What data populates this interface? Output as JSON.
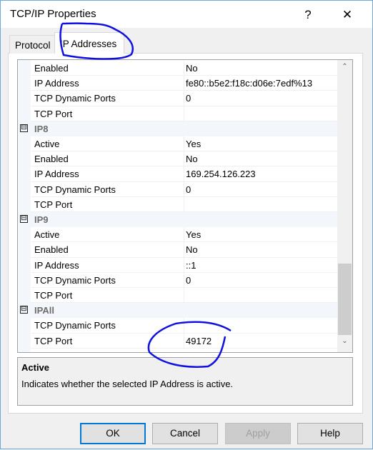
{
  "window": {
    "title": "TCP/IP Properties",
    "help_label": "?",
    "close_label": "✕"
  },
  "tabs": [
    {
      "label": "Protocol",
      "active": false
    },
    {
      "label": "IP Addresses",
      "active": true
    }
  ],
  "grid": {
    "rows": [
      {
        "type": "prop",
        "name": "Enabled",
        "value": "No"
      },
      {
        "type": "prop",
        "name": "IP Address",
        "value": "fe80::b5e2:f18c:d06e:7edf%13"
      },
      {
        "type": "prop",
        "name": "TCP Dynamic Ports",
        "value": "0"
      },
      {
        "type": "prop",
        "name": "TCP Port",
        "value": ""
      },
      {
        "type": "category",
        "name": "IP8",
        "toggle": "⊟"
      },
      {
        "type": "prop",
        "name": "Active",
        "value": "Yes"
      },
      {
        "type": "prop",
        "name": "Enabled",
        "value": "No"
      },
      {
        "type": "prop",
        "name": "IP Address",
        "value": "169.254.126.223"
      },
      {
        "type": "prop",
        "name": "TCP Dynamic Ports",
        "value": "0"
      },
      {
        "type": "prop",
        "name": "TCP Port",
        "value": ""
      },
      {
        "type": "category",
        "name": "IP9",
        "toggle": "⊟"
      },
      {
        "type": "prop",
        "name": "Active",
        "value": "Yes"
      },
      {
        "type": "prop",
        "name": "Enabled",
        "value": "No"
      },
      {
        "type": "prop",
        "name": "IP Address",
        "value": "::1"
      },
      {
        "type": "prop",
        "name": "TCP Dynamic Ports",
        "value": "0"
      },
      {
        "type": "prop",
        "name": "TCP Port",
        "value": ""
      },
      {
        "type": "category",
        "name": "IPAll",
        "toggle": "⊟"
      },
      {
        "type": "prop",
        "name": "TCP Dynamic Ports",
        "value": ""
      },
      {
        "type": "prop",
        "name": "TCP Port",
        "value": "49172"
      }
    ],
    "scroll_up": "⌃",
    "scroll_down": "⌄"
  },
  "description": {
    "heading": "Active",
    "text": "Indicates whether the selected IP Address is active."
  },
  "buttons": {
    "ok": "OK",
    "cancel": "Cancel",
    "apply": "Apply",
    "help": "Help"
  },
  "annotation_color": "#1010e0"
}
